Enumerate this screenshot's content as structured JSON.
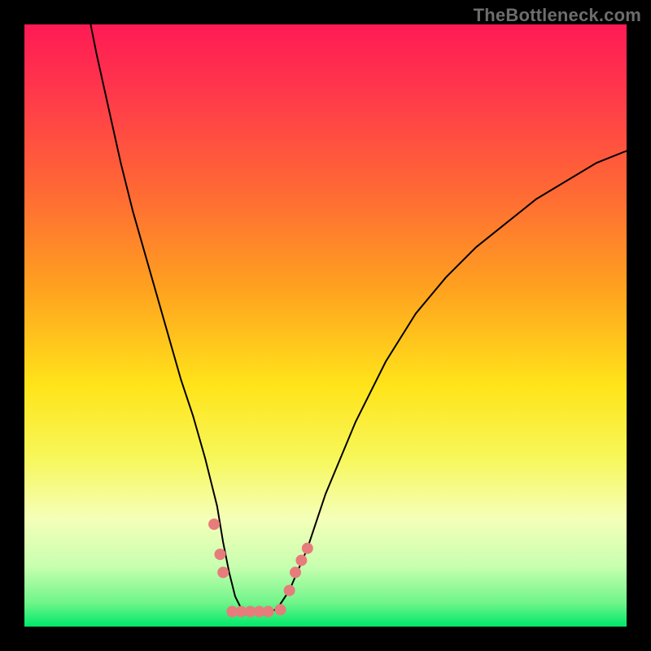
{
  "watermark": "TheBottleneck.com",
  "chart_data": {
    "type": "line",
    "title": "",
    "xlabel": "",
    "ylabel": "",
    "xlim": [
      0,
      100
    ],
    "ylim": [
      0,
      100
    ],
    "grid": false,
    "legend": false,
    "gradient_stops": [
      {
        "pos": 0,
        "color": "#ff1a55"
      },
      {
        "pos": 0.12,
        "color": "#ff3a4a"
      },
      {
        "pos": 0.28,
        "color": "#ff6a34"
      },
      {
        "pos": 0.44,
        "color": "#ffa21f"
      },
      {
        "pos": 0.6,
        "color": "#ffe41a"
      },
      {
        "pos": 0.72,
        "color": "#f7f75a"
      },
      {
        "pos": 0.82,
        "color": "#f5ffb8"
      },
      {
        "pos": 0.9,
        "color": "#c8ffb0"
      },
      {
        "pos": 0.96,
        "color": "#70f58a"
      },
      {
        "pos": 1.0,
        "color": "#00e86a"
      }
    ],
    "series": [
      {
        "name": "bottleneck-curve",
        "color": "#000000",
        "x": [
          11,
          12,
          14,
          16,
          18,
          20,
          22,
          24,
          26,
          28,
          30,
          32,
          33,
          34,
          35,
          36,
          37,
          38,
          40,
          41,
          42,
          44,
          47,
          50,
          55,
          60,
          65,
          70,
          75,
          80,
          85,
          90,
          95,
          100
        ],
        "y": [
          100,
          95,
          86,
          77,
          69,
          62,
          55,
          48,
          41,
          35,
          28,
          20,
          14,
          9,
          5,
          3,
          2.5,
          2.5,
          2.5,
          2.5,
          3,
          6,
          13,
          22,
          34,
          44,
          52,
          58,
          63,
          67,
          71,
          74,
          77,
          79
        ]
      }
    ],
    "markers": {
      "name": "highlight-dots",
      "color": "#e77c7c",
      "points": [
        {
          "x": 31.5,
          "y": 17
        },
        {
          "x": 32.5,
          "y": 12
        },
        {
          "x": 33.0,
          "y": 9
        },
        {
          "x": 34.5,
          "y": 2.5
        },
        {
          "x": 36.0,
          "y": 2.5
        },
        {
          "x": 37.5,
          "y": 2.5
        },
        {
          "x": 39.0,
          "y": 2.5
        },
        {
          "x": 40.5,
          "y": 2.5
        },
        {
          "x": 42.5,
          "y": 2.8
        },
        {
          "x": 44.0,
          "y": 6
        },
        {
          "x": 45.0,
          "y": 9
        },
        {
          "x": 46.0,
          "y": 11
        },
        {
          "x": 47.0,
          "y": 13
        }
      ]
    }
  }
}
